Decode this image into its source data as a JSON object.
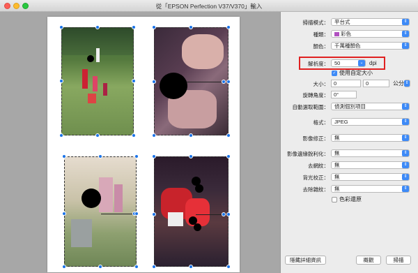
{
  "window": {
    "title": "從「EPSON Perfection V37/V370」輸入"
  },
  "panel": {
    "scan_mode_label": "掃描模式：",
    "scan_mode": "平台式",
    "type_label": "種類：",
    "type": "彩色",
    "color_label": "顏色：",
    "color": "千萬種顏色",
    "resolution_label": "解析度：",
    "resolution": "50",
    "resolution_unit": "dpi",
    "custom_size_label": "使用自定大小",
    "size_label": "大小：",
    "size_w": "0",
    "size_h": "0",
    "size_unit": "公分",
    "rotation_label": "旋轉角度：",
    "rotation": "0°",
    "auto_select_label": "自動選取範圍：",
    "auto_select": "偵測個別項目",
    "format_label": "格式：",
    "format": "JPEG",
    "image_correction_label": "影像修正：",
    "image_correction": "無",
    "unsharp_label": "影像邊緣銳利化：",
    "unsharp": "無",
    "descreen_label": "去網紋：",
    "descreen": "無",
    "backlight_label": "背光校正：",
    "backlight": "無",
    "dust_label": "去除雜紋：",
    "dust": "無",
    "color_restore_label": "色彩還原",
    "hide_details": "隱藏詳細資訊",
    "overview": "概觀",
    "scan": "掃描"
  },
  "colors": {
    "accent": "#3d8af7",
    "highlight": "#e02020"
  }
}
